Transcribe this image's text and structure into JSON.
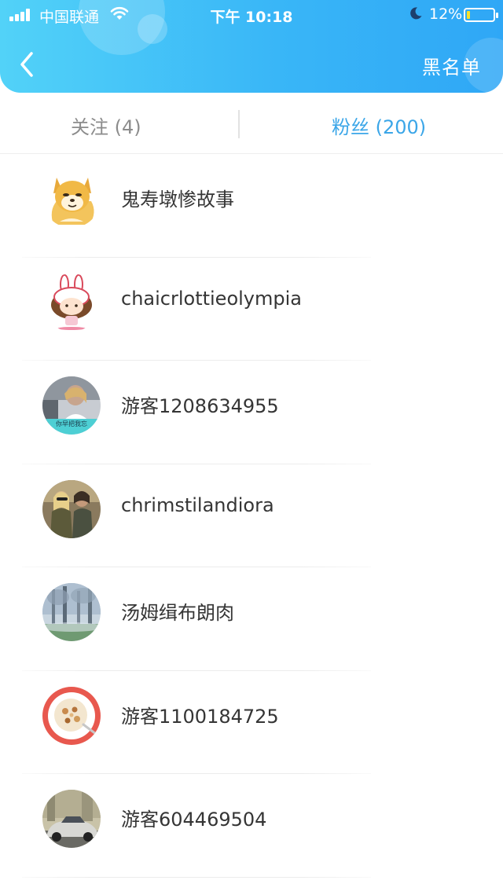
{
  "status_bar": {
    "carrier": "中国联通",
    "time": "下午 10:18",
    "battery_pct": "12%",
    "battery_level": 0.12
  },
  "nav": {
    "back_icon": "chevron-left-icon",
    "blacklist_label": "黑名单"
  },
  "tabs": [
    {
      "label": "关注 (4)",
      "active": false
    },
    {
      "label": "粉丝 (200)",
      "active": true
    }
  ],
  "colors": {
    "header_start": "#52d2f8",
    "header_end": "#2fa7f6",
    "active_tab": "#3ba6e8",
    "inactive_tab": "#8c8c8c"
  },
  "fans": [
    {
      "name": "鬼寿墩惨故事",
      "avatar": "shiba-dog-cartoon-avatar"
    },
    {
      "name": "chaicrlottieolympia",
      "avatar": "bunny-hat-girl-cartoon-avatar"
    },
    {
      "name": "游客1208634955",
      "avatar": "girl-photo-avatar",
      "avatar_caption": "你早把我忘"
    },
    {
      "name": "chrimstilandiora",
      "avatar": "couple-photo-avatar"
    },
    {
      "name": "汤姆缉布朗肉",
      "avatar": "misty-forest-avatar"
    },
    {
      "name": "游客1100184725",
      "avatar": "food-bowl-avatar"
    },
    {
      "name": "游客604469504",
      "avatar": "car-photo-avatar"
    }
  ]
}
